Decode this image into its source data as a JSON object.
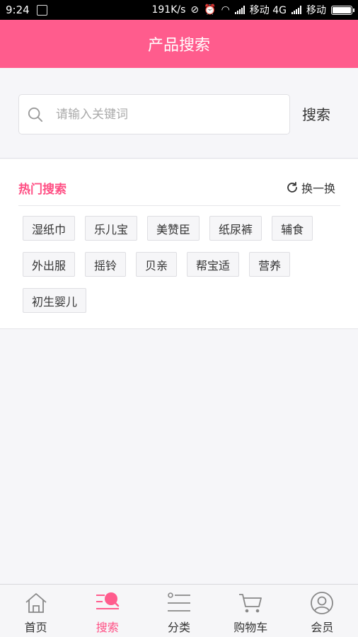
{
  "status_bar": {
    "time": "9:24",
    "speed": "191K/s",
    "carrier1": "移动 4G",
    "carrier2": "移动"
  },
  "header": {
    "title": "产品搜索"
  },
  "search": {
    "placeholder": "请输入关键词",
    "button_label": "搜索"
  },
  "hot": {
    "title": "热门搜索",
    "refresh_label": "换一换",
    "tags": [
      "湿纸巾",
      "乐儿宝",
      "美赞臣",
      "纸尿裤",
      "辅食",
      "外出服",
      "摇铃",
      "贝亲",
      "帮宝适",
      "营养",
      "初生婴儿"
    ]
  },
  "tabbar": {
    "items": [
      {
        "label": "首页",
        "icon": "home-icon"
      },
      {
        "label": "搜索",
        "icon": "search-icon",
        "active": true
      },
      {
        "label": "分类",
        "icon": "category-icon"
      },
      {
        "label": "购物车",
        "icon": "cart-icon"
      },
      {
        "label": "会员",
        "icon": "member-icon"
      }
    ]
  },
  "colors": {
    "accent": "#ff5c8d",
    "accent_text": "#ff4f84"
  }
}
